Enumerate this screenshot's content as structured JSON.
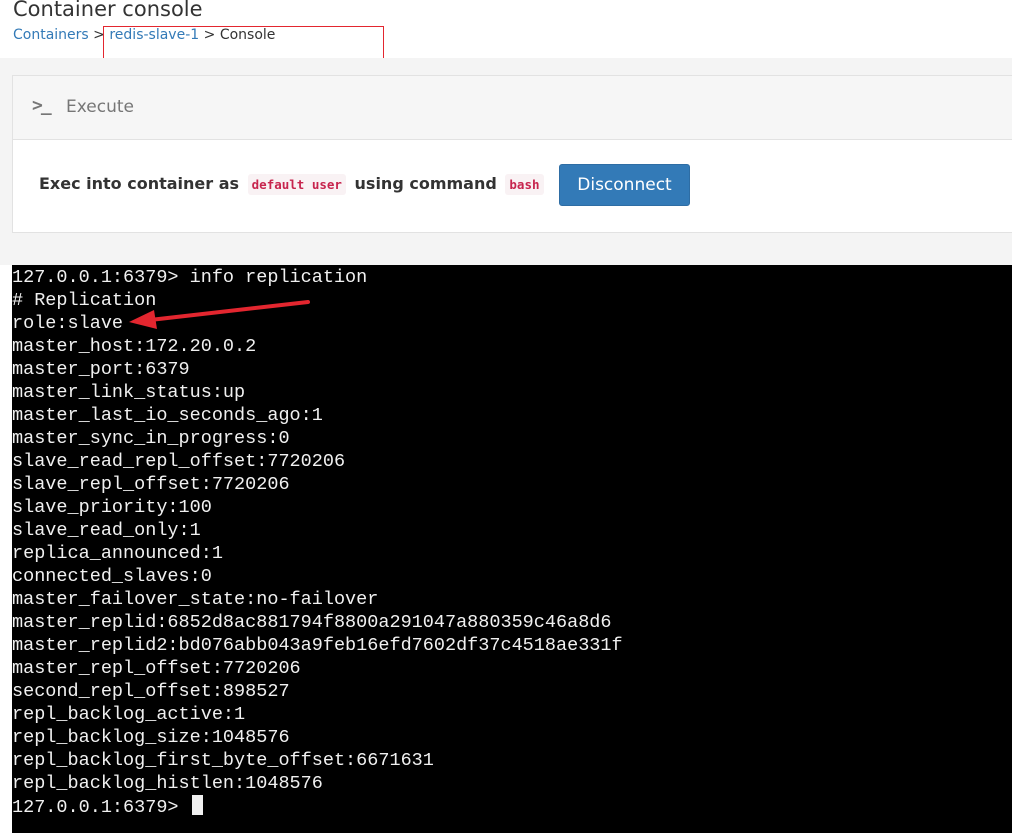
{
  "page": {
    "title": "Container console",
    "breadcrumb": {
      "containers": "Containers",
      "container": "redis-slave-1",
      "current": "Console",
      "separator": ">"
    }
  },
  "widget": {
    "icon": "terminal-prompt-icon",
    "title": "Execute",
    "exec_prefix": "Exec into container as",
    "user": "default user",
    "using": "using command",
    "command": "bash",
    "disconnect_label": "Disconnect"
  },
  "terminal": {
    "lines": [
      "127.0.0.1:6379> info replication",
      "# Replication",
      "role:slave",
      "master_host:172.20.0.2",
      "master_port:6379",
      "master_link_status:up",
      "master_last_io_seconds_ago:1",
      "master_sync_in_progress:0",
      "slave_read_repl_offset:7720206",
      "slave_repl_offset:7720206",
      "slave_priority:100",
      "slave_read_only:1",
      "replica_announced:1",
      "connected_slaves:0",
      "master_failover_state:no-failover",
      "master_replid:6852d8ac881794f8800a291047a880359c46a8d6",
      "master_replid2:bd076abb043a9feb16efd7602df37c4518ae331f",
      "master_repl_offset:7720206",
      "second_repl_offset:898527",
      "repl_backlog_active:1",
      "repl_backlog_size:1048576",
      "repl_backlog_first_byte_offset:6671631",
      "repl_backlog_histlen:1048576"
    ],
    "prompt": "127.0.0.1:6379> "
  },
  "colors": {
    "link": "#337ab7",
    "button": "#337ab7",
    "annotation": "#e3262f",
    "terminal_bg": "#000000",
    "terminal_fg": "#f0f0f0"
  }
}
